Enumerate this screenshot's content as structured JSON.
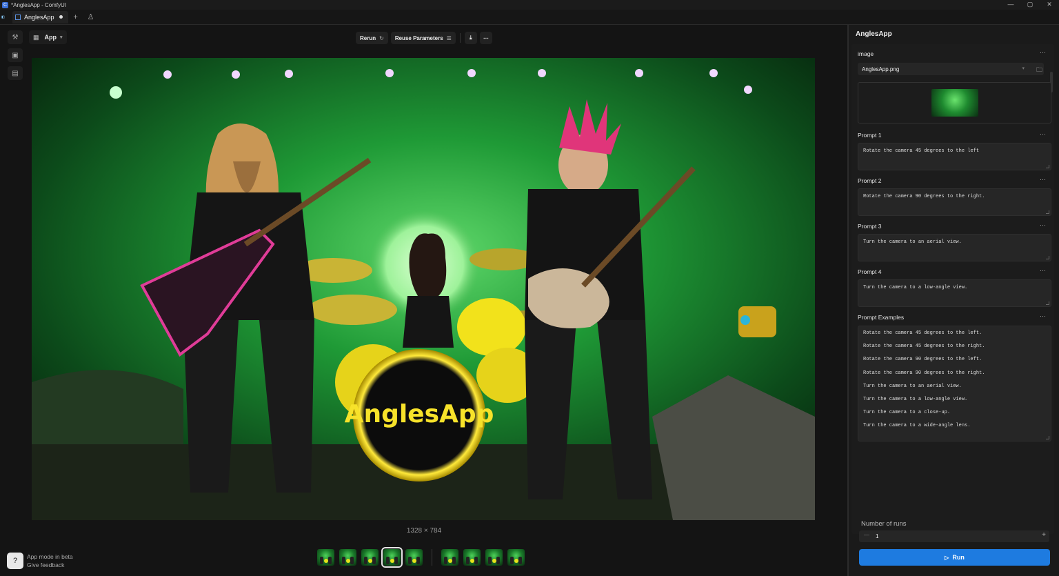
{
  "window": {
    "title": "*AnglesApp - ComfyUI",
    "controls": [
      "—",
      "▢",
      "✕"
    ]
  },
  "tabs": [
    {
      "label": "AnglesApp",
      "modified": true
    }
  ],
  "tabbar": {
    "add_icon": "+",
    "user_icon": "♙"
  },
  "toolbar": {
    "mode_label": "App",
    "rerun_label": "Rerun",
    "reuse_label": "Reuse Parameters"
  },
  "image": {
    "dimensions": "1328 × 784",
    "logo_text": "AnglesApp"
  },
  "beta": {
    "line1": "App mode in beta",
    "line2": "Give feedback"
  },
  "panel": {
    "title": "AnglesApp",
    "image_label": "image",
    "image_file": "AnglesApp.png",
    "prompts": [
      {
        "label": "Prompt 1",
        "value": "Rotate the camera 45 degrees to the left"
      },
      {
        "label": "Prompt 2",
        "value": "Rotate the camera 90  degrees to the right."
      },
      {
        "label": "Prompt 3",
        "value": "Turn the camera to an aerial view."
      },
      {
        "label": "Prompt 4",
        "value": "Turn the camera to a low-angle view."
      }
    ],
    "examples_label": "Prompt Examples",
    "examples": [
      "Rotate the camera 45 degrees to the left.",
      "Rotate the camera 45 degrees to the right.",
      "Rotate the camera 90 degrees to the left.",
      "Rotate the camera 90  degrees to the right.",
      "Turn the camera to an aerial view.",
      "Turn the camera to a low-angle view.",
      "Turn the camera to a close-up.",
      "Turn the camera to a wide-angle lens."
    ],
    "runs_label": "Number of runs",
    "runs_value": "1",
    "run_label": "Run"
  },
  "colors": {
    "accent": "#1e7be0",
    "stage_green": "#1faa3a",
    "drum_yellow": "#f2e21b",
    "hair_pink": "#e0357a"
  }
}
